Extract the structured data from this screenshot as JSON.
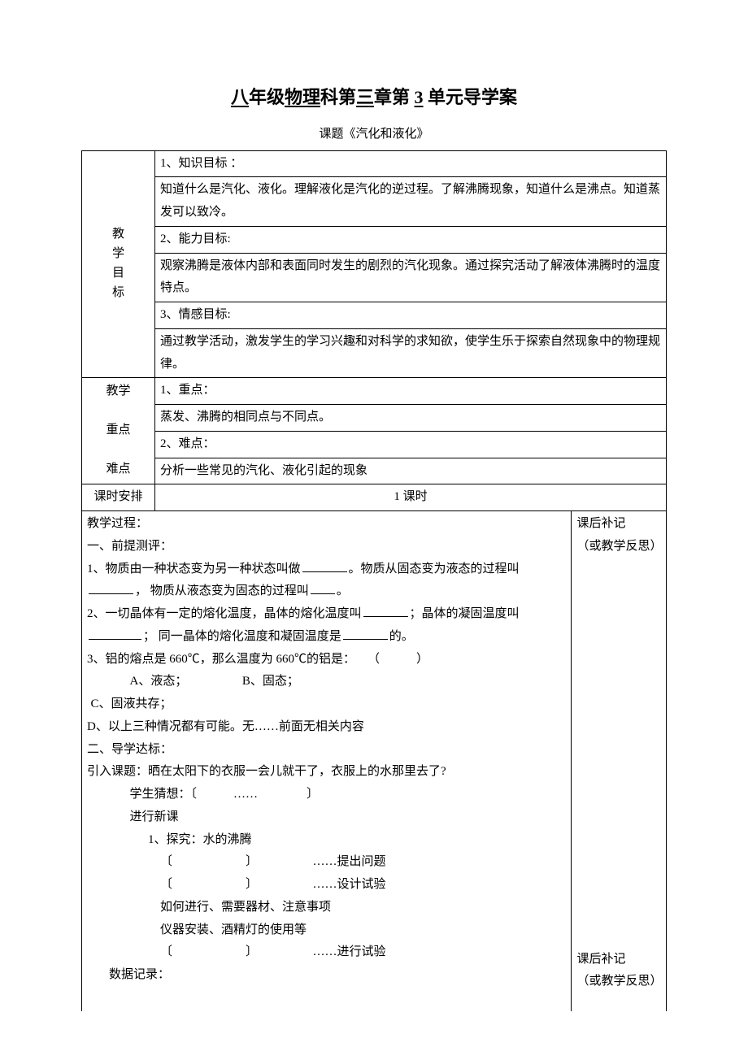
{
  "title_parts": {
    "p1": "八",
    "p2": "年级",
    "p3": "物理",
    "p4": "科第",
    "p5": "三",
    "p6": "章第",
    "p7": "3",
    "p8": "单元导学案"
  },
  "subtitle": "课题《汽化和液化》",
  "labels": {
    "goals": "教\n学\n目\n标",
    "focus": "教学\n重点\n难点",
    "period": "课时安排",
    "period_value": "1 课时",
    "notes1_a": "课后补记",
    "notes1_b": "（或教学反思）",
    "notes2_a": "课后补记",
    "notes2_b": "（或教学反思）"
  },
  "goals": {
    "r1": "1、知识目标 ：",
    "r2": "知道什么是汽化、液化。理解液化是汽化的逆过程。了解沸腾现象，知道什么是沸点。知道蒸发可以致冷。",
    "r3": "2、能力目标:",
    "r4": "观察沸腾是液体内部和表面同时发生的剧烈的汽化现象。通过探究活动了解液体沸腾时的温度特点。",
    "r5": "3、情感目标:",
    "r6": "通过教学活动，激发学生的学习兴趣和对科学的求知欲，使学生乐于探索自然现象中的物理规律。"
  },
  "focus": {
    "r1": "1、重点：",
    "r2": "蒸发、沸腾的相同点与不同点。",
    "r3": "2、难点：",
    "r4": "分析一些常见的汽化、液化引起的现象"
  },
  "process": {
    "h1": "教学过程：",
    "h2": "一、前提测评：",
    "q1a": "1、物质由一种状态变为另一种状态叫做",
    "q1b": "。物质从固态变为液态的过程叫",
    "q1c": "， 物质从液态变为固态的过程叫",
    "q1d": "。",
    "q2a": "2、一切晶体有一定的熔化温度，晶体的熔化温度叫",
    "q2b": "；晶体的凝固温度叫",
    "q2c": "； 同一晶体的熔化温度和凝固温度是",
    "q2d": "的。",
    "q3": "3、铝的熔点是 660℃，那么温度为 660℃的铝是：　　（　　　）",
    "q3a": "A、液态；　　　　　B、固态；",
    "q3c": "C、固液共存；",
    "q3d": "D、以上三种情况都有可能。无……前面无相关内容",
    "h3": "二、导学达标：",
    "intro": "引入课题：晒在太阳下的衣服一会儿就干了，衣服上的水那里去了?",
    "guess": "学生猜想：〔　　　……　　　　〕",
    "newc": "进行新课",
    "exp1": "1、探究：水的沸腾",
    "exp_q": "〔　　　　　　〕　　　　　……提出问题",
    "exp_d": "〔　　　　　　〕　　　　　……设计试验",
    "exp_h": "如何进行、需要器材、注意事项",
    "exp_i": "仪器安装、酒精灯的使用等",
    "exp_r": "〔　　　　　　〕　　　　　……进行试验",
    "rec": "数据记录："
  }
}
